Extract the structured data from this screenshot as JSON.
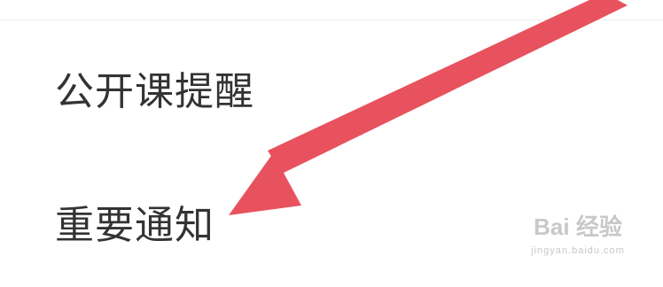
{
  "settings_list": {
    "items": [
      {
        "label": "公开课提醒"
      },
      {
        "label": "重要通知"
      }
    ]
  },
  "annotation": {
    "arrow_color": "#e8525e"
  },
  "watermark": {
    "brand": "Bai 经验",
    "url": "jingyan.baidu.com"
  }
}
